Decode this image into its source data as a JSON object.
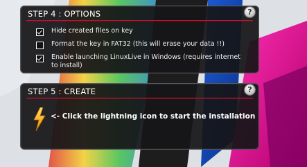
{
  "step4": {
    "title": "STEP 4 : OPTIONS",
    "help_icon": "question-icon",
    "options": [
      {
        "label": "Hide created files on key",
        "checked": true
      },
      {
        "label": "Format the key in FAT32 (this will erase your data !!)",
        "checked": false
      },
      {
        "label": "Enable launching LinuxLive in Windows (requires internet to install)",
        "checked": true
      }
    ]
  },
  "step5": {
    "title": "STEP 5 : CREATE",
    "help_icon": "question-icon",
    "action_icon": "lightning-icon",
    "instruction": "<- Click the lightning icon to start the installation"
  },
  "colors": {
    "panel_bg": "#161618",
    "accent_rule": "#c8102e",
    "lightning": "#f7b21a"
  }
}
